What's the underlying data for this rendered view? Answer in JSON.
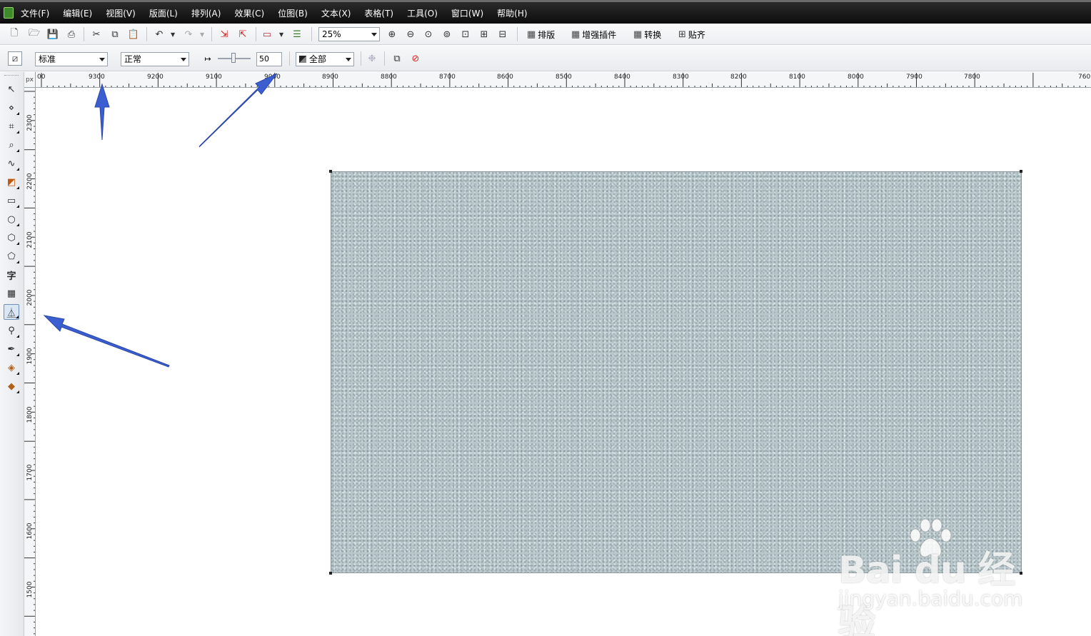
{
  "menu": {
    "items": [
      "文件(F)",
      "编辑(E)",
      "视图(V)",
      "版面(L)",
      "排列(A)",
      "效果(C)",
      "位图(B)",
      "文本(X)",
      "表格(T)",
      "工具(O)",
      "窗口(W)",
      "帮助(H)"
    ]
  },
  "toolbar": {
    "zoom_value": "25%",
    "plugins": [
      "排版",
      "增强插件",
      "转换",
      "贴齐"
    ]
  },
  "property_bar": {
    "style_value": "标准",
    "mode_value": "正常",
    "amount_value": "50",
    "scope_value": "全部"
  },
  "ruler": {
    "corner_label": "px",
    "horizontal_labels": [
      "00",
      "9300",
      "9200",
      "9100",
      "9000",
      "8900",
      "8800",
      "8700",
      "8600",
      "8500",
      "8400",
      "8300",
      "8200",
      "8100",
      "8000",
      "7900",
      "7800",
      "760"
    ],
    "vertical_labels": [
      "2300",
      "2200",
      "2100",
      "2000",
      "1900",
      "1800",
      "1700",
      "1600",
      "1500"
    ]
  },
  "watermark": {
    "logo_text": "Bai du 经验",
    "sub_text": "jingyan.baidu.com"
  },
  "colors": {
    "menubar_bg": "#1a1a1a",
    "annotation_arrow": "#3b5fd0",
    "texture_base": "#b9c7ca"
  }
}
